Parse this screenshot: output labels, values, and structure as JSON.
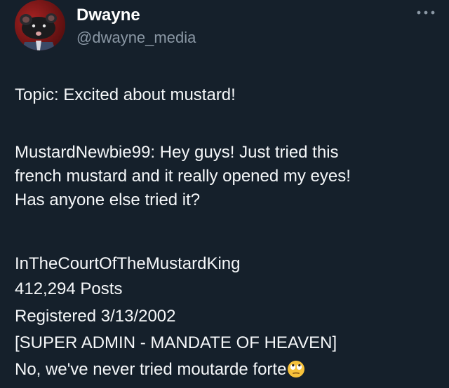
{
  "tweet": {
    "author": {
      "display_name": "Dwayne",
      "handle": "@dwayne_media",
      "avatar_icon": "rat-avatar-icon"
    },
    "more_icon": "more-options-icon",
    "lines": [
      "Topic: Excited about mustard!",
      "MustardNewbie99: Hey guys! Just tried this",
      "french mustard and it really opened my eyes!",
      "Has anyone else tried it?",
      "InTheCourtOfTheMustardKing",
      "412,294 Posts",
      "Registered 3/13/2002",
      "[SUPER ADMIN - MANDATE OF HEAVEN]",
      "No, we've never tried moutarde forte"
    ],
    "emoji": "face-with-rolling-eyes-emoji"
  },
  "colors": {
    "background": "#15202b",
    "text": "#ffffff",
    "secondary_text": "#8b98a5",
    "avatar_bg": "#7a1616"
  }
}
